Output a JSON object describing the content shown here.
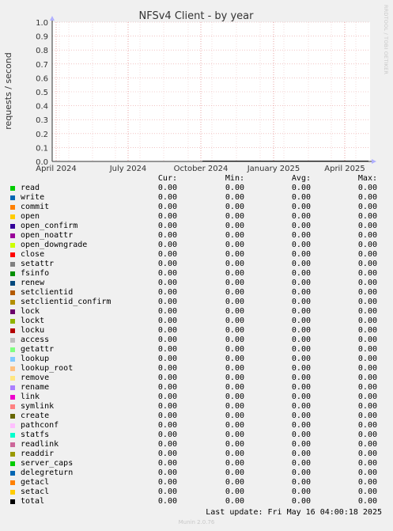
{
  "chart_data": {
    "type": "line",
    "title": "NFSv4 Client - by year",
    "ylabel": "requests / second",
    "xlabel": "",
    "ylim": [
      0,
      1.0
    ],
    "yticks": [
      "0.0",
      "0.1",
      "0.2",
      "0.3",
      "0.4",
      "0.5",
      "0.6",
      "0.7",
      "0.8",
      "0.9",
      "1.0"
    ],
    "xticks": [
      "April 2024",
      "July 2024",
      "October 2024",
      "January 2025",
      "April 2025"
    ],
    "grid": true,
    "series_values_note": "",
    "line_start_label": "October 2024",
    "line_value": 0.0
  },
  "watermark": "RRDTOOL / TOBI OETIKER",
  "legend": {
    "headers": {
      "cur": "Cur:",
      "min": "Min:",
      "avg": "Avg:",
      "max": "Max:"
    },
    "rows": [
      {
        "name": "read",
        "color": "#00cc00",
        "cur": "0.00",
        "min": "0.00",
        "avg": "0.00",
        "max": "0.00"
      },
      {
        "name": "write",
        "color": "#0066b3",
        "cur": "0.00",
        "min": "0.00",
        "avg": "0.00",
        "max": "0.00"
      },
      {
        "name": "commit",
        "color": "#ff8000",
        "cur": "0.00",
        "min": "0.00",
        "avg": "0.00",
        "max": "0.00"
      },
      {
        "name": "open",
        "color": "#ffcc00",
        "cur": "0.00",
        "min": "0.00",
        "avg": "0.00",
        "max": "0.00"
      },
      {
        "name": "open_confirm",
        "color": "#330099",
        "cur": "0.00",
        "min": "0.00",
        "avg": "0.00",
        "max": "0.00"
      },
      {
        "name": "open_noattr",
        "color": "#990099",
        "cur": "0.00",
        "min": "0.00",
        "avg": "0.00",
        "max": "0.00"
      },
      {
        "name": "open_downgrade",
        "color": "#ccff00",
        "cur": "0.00",
        "min": "0.00",
        "avg": "0.00",
        "max": "0.00"
      },
      {
        "name": "close",
        "color": "#ff0000",
        "cur": "0.00",
        "min": "0.00",
        "avg": "0.00",
        "max": "0.00"
      },
      {
        "name": "setattr",
        "color": "#808080",
        "cur": "0.00",
        "min": "0.00",
        "avg": "0.00",
        "max": "0.00"
      },
      {
        "name": "fsinfo",
        "color": "#008f00",
        "cur": "0.00",
        "min": "0.00",
        "avg": "0.00",
        "max": "0.00"
      },
      {
        "name": "renew",
        "color": "#00487d",
        "cur": "0.00",
        "min": "0.00",
        "avg": "0.00",
        "max": "0.00"
      },
      {
        "name": "setclientid",
        "color": "#b35a00",
        "cur": "0.00",
        "min": "0.00",
        "avg": "0.00",
        "max": "0.00"
      },
      {
        "name": "setclientid_confirm",
        "color": "#b38f00",
        "cur": "0.00",
        "min": "0.00",
        "avg": "0.00",
        "max": "0.00"
      },
      {
        "name": "lock",
        "color": "#6b006b",
        "cur": "0.00",
        "min": "0.00",
        "avg": "0.00",
        "max": "0.00"
      },
      {
        "name": "lockt",
        "color": "#8fb300",
        "cur": "0.00",
        "min": "0.00",
        "avg": "0.00",
        "max": "0.00"
      },
      {
        "name": "locku",
        "color": "#b30000",
        "cur": "0.00",
        "min": "0.00",
        "avg": "0.00",
        "max": "0.00"
      },
      {
        "name": "access",
        "color": "#bebebe",
        "cur": "0.00",
        "min": "0.00",
        "avg": "0.00",
        "max": "0.00"
      },
      {
        "name": "getattr",
        "color": "#80ff80",
        "cur": "0.00",
        "min": "0.00",
        "avg": "0.00",
        "max": "0.00"
      },
      {
        "name": "lookup",
        "color": "#80c9ff",
        "cur": "0.00",
        "min": "0.00",
        "avg": "0.00",
        "max": "0.00"
      },
      {
        "name": "lookup_root",
        "color": "#ffc080",
        "cur": "0.00",
        "min": "0.00",
        "avg": "0.00",
        "max": "0.00"
      },
      {
        "name": "remove",
        "color": "#ffe680",
        "cur": "0.00",
        "min": "0.00",
        "avg": "0.00",
        "max": "0.00"
      },
      {
        "name": "rename",
        "color": "#aa80ff",
        "cur": "0.00",
        "min": "0.00",
        "avg": "0.00",
        "max": "0.00"
      },
      {
        "name": "link",
        "color": "#ee00cc",
        "cur": "0.00",
        "min": "0.00",
        "avg": "0.00",
        "max": "0.00"
      },
      {
        "name": "symlink",
        "color": "#ff8080",
        "cur": "0.00",
        "min": "0.00",
        "avg": "0.00",
        "max": "0.00"
      },
      {
        "name": "create",
        "color": "#666600",
        "cur": "0.00",
        "min": "0.00",
        "avg": "0.00",
        "max": "0.00"
      },
      {
        "name": "pathconf",
        "color": "#ffbfff",
        "cur": "0.00",
        "min": "0.00",
        "avg": "0.00",
        "max": "0.00"
      },
      {
        "name": "statfs",
        "color": "#00ffcc",
        "cur": "0.00",
        "min": "0.00",
        "avg": "0.00",
        "max": "0.00"
      },
      {
        "name": "readlink",
        "color": "#cc6699",
        "cur": "0.00",
        "min": "0.00",
        "avg": "0.00",
        "max": "0.00"
      },
      {
        "name": "readdir",
        "color": "#999900",
        "cur": "0.00",
        "min": "0.00",
        "avg": "0.00",
        "max": "0.00"
      },
      {
        "name": "server_caps",
        "color": "#00cc00",
        "cur": "0.00",
        "min": "0.00",
        "avg": "0.00",
        "max": "0.00"
      },
      {
        "name": "delegreturn",
        "color": "#0066b3",
        "cur": "0.00",
        "min": "0.00",
        "avg": "0.00",
        "max": "0.00"
      },
      {
        "name": "getacl",
        "color": "#ff8000",
        "cur": "0.00",
        "min": "0.00",
        "avg": "0.00",
        "max": "0.00"
      },
      {
        "name": "setacl",
        "color": "#ffcc00",
        "cur": "0.00",
        "min": "0.00",
        "avg": "0.00",
        "max": "0.00"
      },
      {
        "name": "total",
        "color": "#000000",
        "cur": "0.00",
        "min": "0.00",
        "avg": "0.00",
        "max": "0.00"
      }
    ]
  },
  "footer": {
    "last_update": "Last update: Fri May 16 04:00:18 2025",
    "munin": "Munin 2.0.76"
  }
}
